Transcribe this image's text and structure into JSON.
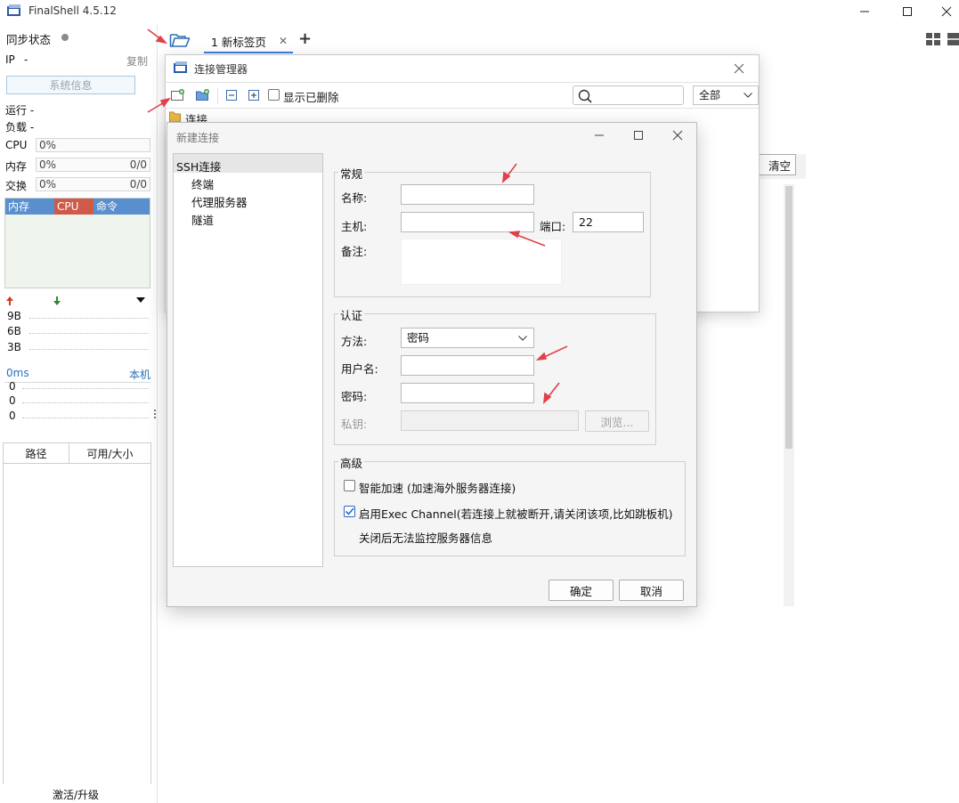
{
  "app": {
    "title": "FinalShell 4.5.12"
  },
  "sidebar": {
    "sync_label": "同步状态",
    "ip_label": "IP",
    "ip_value": "-",
    "copy_label": "复制",
    "sysinfo_button": "系统信息",
    "uptime_label": "运行 -",
    "load_label": "负载 -",
    "cpu_label": "CPU",
    "cpu_value": "0%",
    "mem_label": "内存",
    "mem_value": "0%",
    "mem_ratio": "0/0",
    "swap_label": "交换",
    "swap_value": "0%",
    "swap_ratio": "0/0",
    "proc_tabs": [
      "内存",
      "CPU",
      "命令"
    ],
    "net_ticks": [
      "9B",
      "6B",
      "3B"
    ],
    "ping_label": "0ms",
    "ping_target": "本机",
    "ping_values": [
      "0",
      "0",
      "0"
    ],
    "fs_columns": [
      "路径",
      "可用/大小"
    ],
    "activate_label": "激活/升级"
  },
  "tabs": {
    "items": [
      {
        "label": "1 新标签页",
        "active": true
      }
    ],
    "close_glyph": "✕",
    "add_glyph": "+"
  },
  "connection_manager": {
    "title": "连接管理器",
    "show_deleted_label": "显示已删除",
    "filter_value": "全部",
    "tree_root": "连接",
    "clear_label": "清空"
  },
  "new_connection": {
    "title": "新建连接",
    "tree": {
      "root": "SSH连接",
      "children": [
        "终端",
        "代理服务器",
        "隧道"
      ]
    },
    "general": {
      "group_label": "常规",
      "name_label": "名称:",
      "name_value": "",
      "host_label": "主机:",
      "host_value": "",
      "port_label": "端口:",
      "port_value": "22",
      "note_label": "备注:",
      "note_value": ""
    },
    "auth": {
      "group_label": "认证",
      "method_label": "方法:",
      "method_value": "密码",
      "user_label": "用户名:",
      "user_value": "",
      "password_label": "密码:",
      "password_value": "",
      "key_label": "私钥:",
      "key_value": "",
      "browse_label": "浏览..."
    },
    "advanced": {
      "group_label": "高级",
      "smart_accel_label": "智能加速 (加速海外服务器连接)",
      "smart_accel_checked": false,
      "exec_channel_label": "启用Exec Channel(若连接上就被断开,请关闭该项,比如跳板机)",
      "exec_channel_checked": true,
      "exec_channel_note": "关闭后无法监控服务器信息"
    },
    "ok_label": "确定",
    "cancel_label": "取消"
  },
  "colors": {
    "accent": "#3b7ddd",
    "proc_mem_header": "#5a8fcf",
    "proc_cpu_header": "#d05a4a",
    "proc_cmd_header": "#5a8fcf",
    "annotation_arrow": "#e0414b",
    "upload_arrow": "#d63a1f",
    "download_arrow": "#2e8b2e",
    "sync_dot": "#8a8a8a",
    "link_blue": "#2a6fb8"
  },
  "icons": {
    "folder": "folder-open-icon",
    "grid": "grid-layout-icon",
    "search": "search-icon",
    "chevron": "chevron-down-icon",
    "check": "check-icon"
  }
}
